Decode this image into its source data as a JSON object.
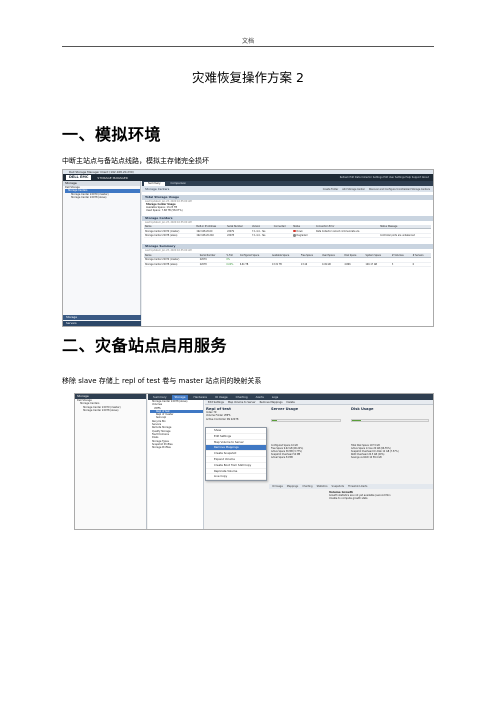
{
  "header": {
    "text": "文档"
  },
  "title": "灾难恢复操作方案 2",
  "section1": {
    "heading": "一、模拟环境",
    "desc": "中断主站点与备站点线路，模拟主存储完全损坏",
    "screenshot": {
      "window_title": "Dell Storage Manager Client (192.168.20.230)",
      "logo": "DELL EMC",
      "app_name": "STORAGE MANAGER",
      "top_links": "Refresh  Edit Data Collector Settings  Edit User Settings  Help  Support  About",
      "left_header": "Storage",
      "tree": [
        "Dell Storage",
        "Storage Centers",
        "Storage Center 22079 (master)",
        "Storage Center 22078 (slave)"
      ],
      "nav": [
        "Storage",
        "Servers"
      ],
      "tabs": [
        "Summary",
        "Comparison"
      ],
      "section_title": "Storage Centers",
      "actions": [
        "Create Folder",
        "Add Storage Center",
        "Discover and Configure Uninitialized Storage Centers"
      ],
      "total_title": "Total Storage Usage",
      "total_sub": "Last Updated: Jan 23, 2020 10:35:00 AM",
      "usage_header": "Storage Center Usage",
      "usage": [
        {
          "k": "Available Space",
          "v": "13.23 TB"
        },
        {
          "k": "Used Space",
          "v": "7.68 TB (58.07%)"
        }
      ],
      "sc_title": "Storage Centers",
      "sc_sub": "Last Updated: Jan 23, 2020 10:35:00 AM",
      "sc_cols": [
        "Name",
        "Built-in IP Address",
        "Serial Number",
        "Version",
        "Connected",
        "Status",
        "Connection Error",
        "Status Message"
      ],
      "sc_rows": [
        [
          "Storage Center 22079 (master)",
          "192.168.20.60",
          "22079",
          "7.1.4.4 - Yes",
          "",
          "Down",
          "Data Collector cannot communicate via",
          ""
        ],
        [
          "Storage Center 22078 (slave)",
          "192.168.20.240",
          "22078",
          "7.1.4.4 - Yes",
          "",
          "Degraded",
          "",
          "Controller ports are unbalanced"
        ]
      ],
      "summary_title": "Storage Summary",
      "summary_sub": "Last Updated: Jan 23, 2020 10:35:00 AM",
      "sum_cols": [
        "Name",
        "Serial Number",
        "% Full",
        "Configured Space",
        "Available Space",
        "Free Space",
        "Used Space",
        "Disk Space",
        "System Space",
        "# Volumes",
        "# Servers"
      ],
      "sum_rows": [
        [
          "Storage Center 22079 (master)",
          "22079",
          "0%",
          "",
          "",
          "",
          "",
          "",
          "",
          "",
          ""
        ],
        [
          "Storage Center 22078 (slave)",
          "22078",
          "0.00%",
          "6.61 TB",
          "13.31 TB",
          "13.16",
          "0.49 GB",
          "4.866",
          "190.17 GB",
          "3",
          "6"
        ]
      ]
    }
  },
  "section2": {
    "heading": "二、灾备站点启用服务",
    "desc": "移除 slave 存储上 repl of test 卷与 master 站点间的映射关系",
    "screenshot": {
      "left_header": "Storage",
      "tree": [
        "Dell Storage",
        "Storage Centers",
        "Storage Center 22079 (master)",
        "Storage Center 22078 (slave)"
      ],
      "tabs": [
        "Summary",
        "Storage",
        "Hardware",
        "IO Usage",
        "Charting",
        "Alerts",
        "Logs"
      ],
      "navtree": [
        "Storage Center 22078 (slave)",
        "Volumes",
        "VMFS",
        "Repl of test",
        "Repl of master",
        "test-repl",
        "Recycle Bin",
        "Servers",
        "Remote Storage",
        "Qualify Storage",
        "Fault Domains",
        "Disks",
        "Storage Types",
        "Snapshot Profiles",
        "Storage Profiles"
      ],
      "toolbar": [
        "Edit Settings",
        "Map Volume to Server",
        "Remove Mappings",
        "Delete"
      ],
      "volume_title": "Repl of test",
      "volume_kv": [
        {
          "k": "Index",
          "v": "79"
        },
        {
          "k": "Volume Folder",
          "v": "VMFS"
        },
        {
          "k": "Active Controller",
          "v": "SN 22078"
        }
      ],
      "menu": [
        "Show",
        "Edit Settings",
        "Map Volume to Server",
        "Remove Mappings",
        "Create Snapshot",
        "Expand Volume",
        "Create Boot from SAN Copy",
        "Replicate Volume",
        "Live Copy"
      ],
      "menu_highlight": "Remove Mappings",
      "server_usage_title": "Server Usage",
      "disk_usage_title": "Disk Usage",
      "server_usage_fraction": 0.08,
      "disk_usage_fraction": 0.12,
      "server_stats": [
        {
          "k": "Configured Space",
          "v": "10 GB"
        },
        {
          "k": "Free Space",
          "v": "9.62 GB (96.22%)"
        },
        {
          "k": "Active Space",
          "v": "36 MB (3.77%)"
        },
        {
          "k": "Snapshot Overhead",
          "v": "54 MB"
        },
        {
          "k": "Actual Space",
          "v": "54 MB"
        }
      ],
      "disk_stats": [
        {
          "k": "Total Disk Space",
          "v": "107.5 GB"
        },
        {
          "k": "Active Space in Use",
          "v": "20 GB (66.55%)"
        },
        {
          "k": "Snapshot Overhead On Disk",
          "v": "12 GB (7.57%)"
        },
        {
          "k": "RAID Overhead",
          "v": "20.5 GB (20%)"
        },
        {
          "k": "Savings vs RAID 10",
          "v": "58.4 GB"
        }
      ],
      "bottom_tabs": [
        "IO Usage",
        "Mappings",
        "Charting",
        "Statistics",
        "Snapshots",
        "Threshold Alerts"
      ],
      "growth_title": "Volume Growth",
      "growth_text": [
        "Growth statistics are not yet available (second Mon",
        "Unable to compute growth stats"
      ]
    }
  }
}
